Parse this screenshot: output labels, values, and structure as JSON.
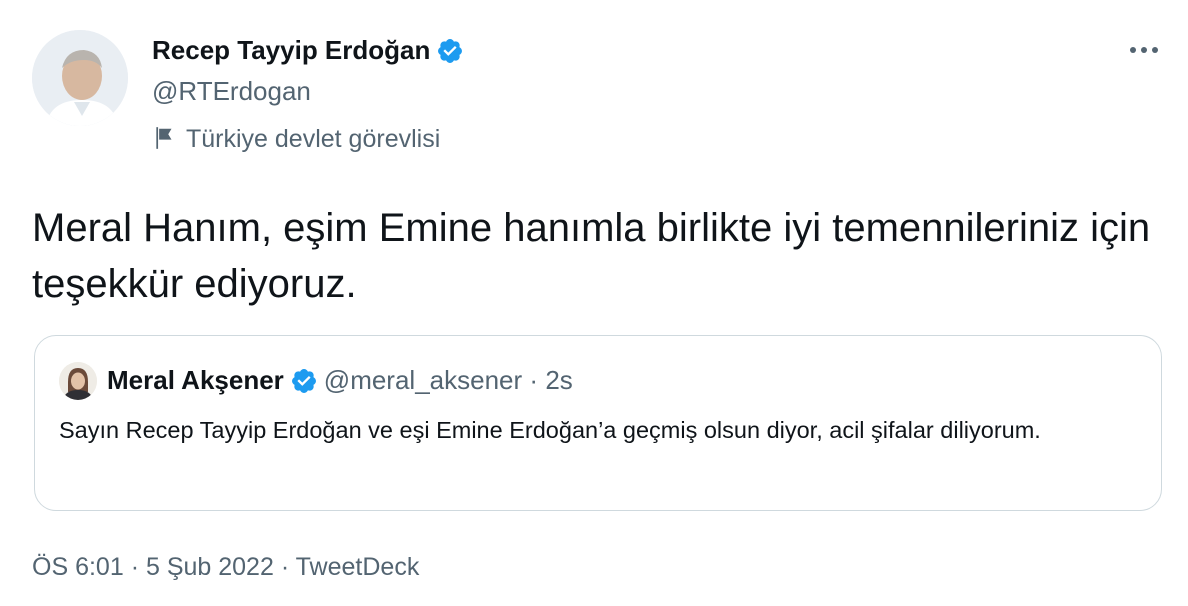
{
  "author": {
    "display_name": "Recep Tayyip Erdoğan",
    "handle": "@RTErdogan",
    "label": "Türkiye devlet görevlisi",
    "verified_icon": "verified-badge-icon",
    "label_icon": "flag-icon"
  },
  "tweet": {
    "text": "Meral Hanım, eşim Emine hanımla birlikte iyi temennileriniz için teşekkür ediyoruz."
  },
  "quoted_tweet": {
    "display_name": "Meral Akşener",
    "handle": "@meral_aksener",
    "separator": "·",
    "time": "2s",
    "text": "Sayın Recep Tayyip Erdoğan ve eşi Emine Erdoğan’a geçmiş olsun diyor, acil şifalar diliyorum."
  },
  "meta": {
    "time": "ÖS 6:01",
    "separator": "·",
    "date": "5 Şub 2022",
    "client": "TweetDeck"
  },
  "colors": {
    "verified_blue": "#1d9bf0",
    "secondary_text": "#536471",
    "border": "#cfd9de"
  }
}
